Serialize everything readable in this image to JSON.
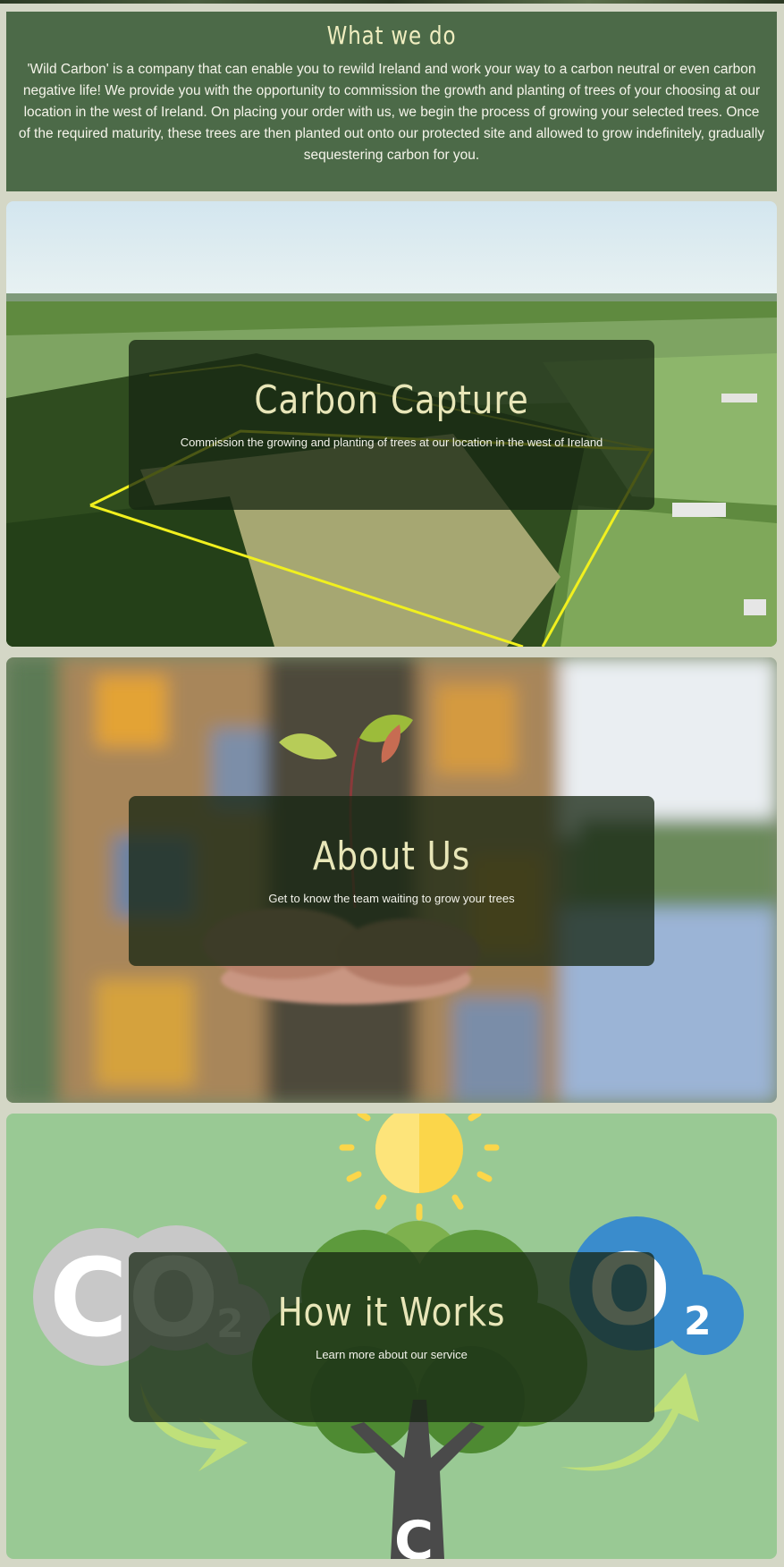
{
  "what_we_do": {
    "title": "What we do",
    "body": "'Wild Carbon' is a company that can enable you to rewild Ireland and work your way to a carbon neutral or even carbon negative life! We provide you with the opportunity to commission the growth and planting of trees of your choosing at our location in the west of Ireland. On placing your order with us, we begin the process of growing your selected trees. Once of the required maturity, these trees are then planted out onto our protected site and allowed to grow indefinitely, gradually sequestering carbon for you."
  },
  "cards": [
    {
      "title": "Carbon Capture",
      "subtitle": "Commission the growing and planting of trees at our location in the west of Ireland",
      "image": "aerial-farmland-photo"
    },
    {
      "title": "About Us",
      "subtitle": "Get to know the team waiting to grow your trees",
      "image": "hands-holding-seedling-photo"
    },
    {
      "title": "How it Works",
      "subtitle": "Learn more about our service",
      "image": "co2-tree-o2-illustration",
      "illustration_text": {
        "co2_letters": "CO",
        "co2_subscript": "2",
        "o2_letter": "O",
        "o2_subscript": "2",
        "trunk_letter": "C"
      }
    }
  ],
  "colors": {
    "page_background": "#d4d7c6",
    "section_green": "#4c6a48",
    "overlay": "#16261288",
    "title_text": "#e8e6b8",
    "illustration_background": "#99c994"
  }
}
